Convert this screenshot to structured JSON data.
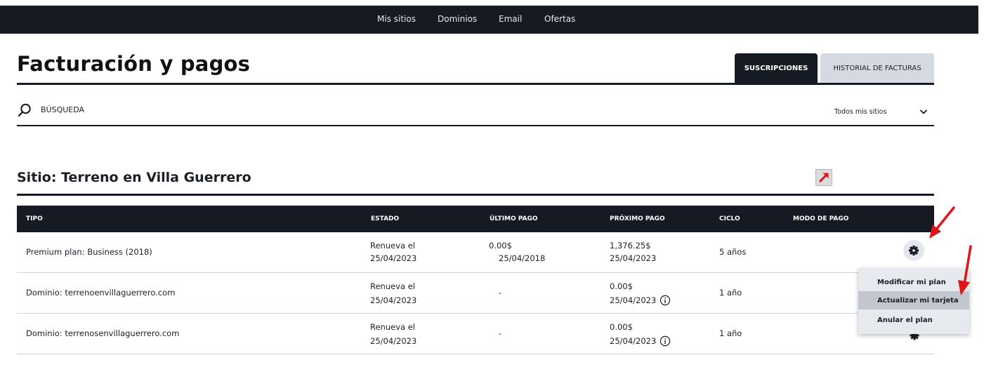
{
  "nav": {
    "items": [
      "Mis sitios",
      "Dominios",
      "Email",
      "Ofertas"
    ]
  },
  "page": {
    "title": "Facturación y pagos"
  },
  "tabs": {
    "active": "SUSCRIPCIONES",
    "inactive": "HISTORIAL DE FACTURAS"
  },
  "search": {
    "label": "BÚSQUEDA"
  },
  "filter": {
    "label": "Todos mis sitios"
  },
  "site": {
    "title": "Sitio: Terreno en Villa Guerrero"
  },
  "table": {
    "headers": [
      "TIPO",
      "ESTADO",
      "ÚLTIMO PAGO",
      "PRÓXIMO PAGO",
      "CICLO",
      "MODO DE PAGO"
    ],
    "rows": [
      {
        "tipo": "Premium plan: Business (2018)",
        "estado": [
          "Renueva el",
          "25/04/2023"
        ],
        "ultimo": [
          "0.00$",
          "25/04/2018"
        ],
        "proximo": [
          "1,376.25$",
          "25/04/2023"
        ],
        "ciclo": "5 años"
      },
      {
        "tipo": "Dominio: terrenoenvillaguerrero.com",
        "estado": [
          "Renueva el",
          "25/04/2023"
        ],
        "ultimo": [
          "-"
        ],
        "proximo": [
          "0.00$",
          "25/04/2023"
        ],
        "ciclo": "1 año"
      },
      {
        "tipo": "Dominio: terrenosenvillaguerrero.com",
        "estado": [
          "Renueva el",
          "25/04/2023"
        ],
        "ultimo": [
          "-"
        ],
        "proximo": [
          "0.00$",
          "25/04/2023"
        ],
        "ciclo": "1 año"
      }
    ]
  },
  "menu": {
    "items": [
      "Modificar mi plan",
      "Actualizar mi tarjeta",
      "Anular el plan"
    ],
    "highlighted": "Actualizar mi tarjeta"
  },
  "icons": {
    "search": "search-icon",
    "chevron": "chevron-down-icon",
    "gear": "gear-icon",
    "external": "external-link-icon",
    "info": "info-icon"
  },
  "colors": {
    "nav_bg": "#161b23",
    "annotation": "#e0151a",
    "menu_bg": "#e6e9ee",
    "menu_highlight": "#c2c7cf"
  }
}
